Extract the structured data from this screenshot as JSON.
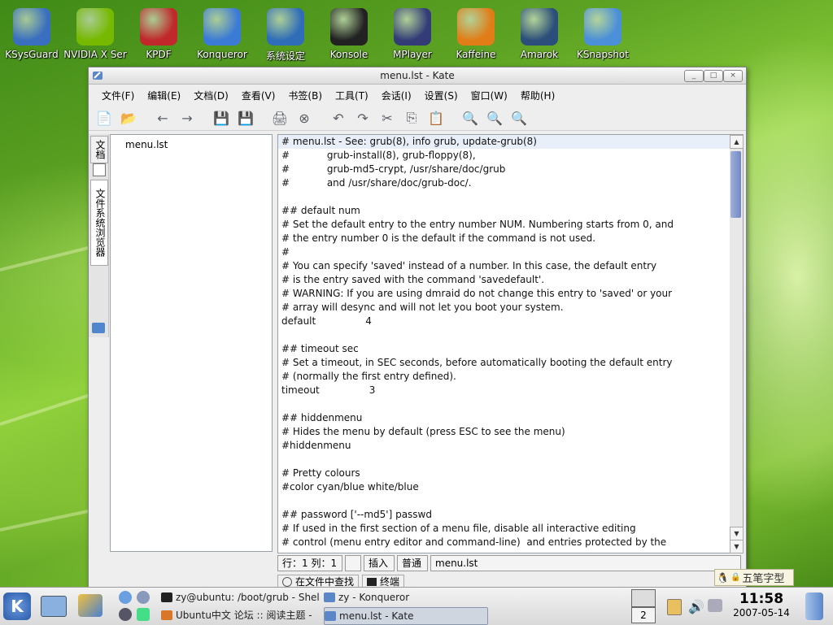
{
  "desktop_icons": [
    {
      "label": "KSysGuard",
      "icon": "ksysguard-icon",
      "color": "#3a6fbf"
    },
    {
      "label": "NVIDIA X Ser",
      "icon": "nvidia-icon",
      "color": "#76b900"
    },
    {
      "label": "KPDF",
      "icon": "kpdf-icon",
      "color": "#c0282b"
    },
    {
      "label": "Konqueror",
      "icon": "konqueror-icon",
      "color": "#3c7bd5"
    },
    {
      "label": "系统设定",
      "icon": "system-settings-icon",
      "color": "#2f6db8"
    },
    {
      "label": "Konsole",
      "icon": "konsole-icon",
      "color": "#222222"
    },
    {
      "label": "MPlayer",
      "icon": "mplayer-icon",
      "color": "#333c77"
    },
    {
      "label": "Kaffeine",
      "icon": "kaffeine-icon",
      "color": "#e07d17"
    },
    {
      "label": "Amarok",
      "icon": "amarok-icon",
      "color": "#2b4e7a"
    },
    {
      "label": "KSnapshot",
      "icon": "ksnapshot-icon",
      "color": "#4a8fd8"
    }
  ],
  "window": {
    "title": "menu.lst - Kate",
    "controls": [
      "_",
      "□",
      "×"
    ]
  },
  "menu": [
    "文件(F)",
    "编辑(E)",
    "文档(D)",
    "查看(V)",
    "书签(B)",
    "工具(T)",
    "会话(I)",
    "设置(S)",
    "窗口(W)",
    "帮助(H)"
  ],
  "toolbar": [
    {
      "name": "new-file-icon",
      "glyph": "📄"
    },
    {
      "name": "open-folder-icon",
      "glyph": "📂"
    },
    {
      "name": "back-icon",
      "glyph": "←"
    },
    {
      "name": "forward-icon",
      "glyph": "→"
    },
    {
      "name": "save-icon",
      "glyph": "💾"
    },
    {
      "name": "save-as-icon",
      "glyph": "💾"
    },
    {
      "name": "print-icon",
      "glyph": "🖨"
    },
    {
      "name": "close-doc-icon",
      "glyph": "⊗"
    },
    {
      "name": "undo-icon",
      "glyph": "↶"
    },
    {
      "name": "redo-icon",
      "glyph": "↷"
    },
    {
      "name": "cut-icon",
      "glyph": "✂"
    },
    {
      "name": "copy-icon",
      "glyph": "⎘"
    },
    {
      "name": "paste-icon",
      "glyph": "📋"
    },
    {
      "name": "find-icon",
      "glyph": "🔍"
    },
    {
      "name": "zoom-in-icon",
      "glyph": "🔍"
    },
    {
      "name": "zoom-out-icon",
      "glyph": "🔍"
    }
  ],
  "sidebar": {
    "tab_documents": "文档",
    "tab_filesystem": "文件系统浏览器",
    "files": [
      "menu.lst"
    ]
  },
  "editor_lines": [
    "# menu.lst - See: grub(8), info grub, update-grub(8)",
    "#            grub-install(8), grub-floppy(8),",
    "#            grub-md5-crypt, /usr/share/doc/grub",
    "#            and /usr/share/doc/grub-doc/.",
    "",
    "## default num",
    "# Set the default entry to the entry number NUM. Numbering starts from 0, and",
    "# the entry number 0 is the default if the command is not used.",
    "#",
    "# You can specify 'saved' instead of a number. In this case, the default entry",
    "# is the entry saved with the command 'savedefault'.",
    "# WARNING: If you are using dmraid do not change this entry to 'saved' or your",
    "# array will desync and will not let you boot your system.",
    "default                4",
    "",
    "## timeout sec",
    "# Set a timeout, in SEC seconds, before automatically booting the default entry",
    "# (normally the first entry defined).",
    "timeout                3",
    "",
    "## hiddenmenu",
    "# Hides the menu by default (press ESC to see the menu)",
    "#hiddenmenu",
    "",
    "# Pretty colours",
    "#color cyan/blue white/blue",
    "",
    "## password ['--md5'] passwd",
    "# If used in the first section of a menu file, disable all interactive editing",
    "# control (menu entry editor and command-line)  and entries protected by the"
  ],
  "statusbar": {
    "position": "行：1 列：1",
    "mode": "插入",
    "sel": "普通",
    "filename": "menu.lst"
  },
  "bottom_tabs": [
    "在文件中查找",
    "终端"
  ],
  "ime_label": "五笔字型",
  "taskbar": {
    "tasks": [
      {
        "label": "zy@ubuntu: /boot/grub - Shel",
        "icon": "terminal-icon",
        "active": false
      },
      {
        "label": "zy - Konqueror",
        "icon": "konqueror-icon",
        "active": false
      },
      {
        "label": "Ubuntu中文 论坛 :: 阅读主题 -",
        "icon": "firefox-icon",
        "active": false
      },
      {
        "label": "menu.lst - Kate",
        "icon": "kate-icon",
        "active": true
      }
    ],
    "desktop_pager": "2",
    "clock_time": "11:58",
    "clock_date": "2007-05-14"
  }
}
